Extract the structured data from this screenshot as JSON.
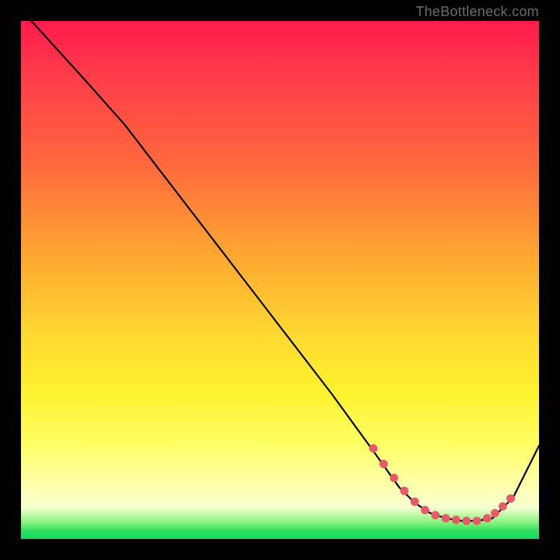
{
  "watermark": "TheBottleneck.com",
  "chart_data": {
    "type": "line",
    "title": "",
    "xlabel": "",
    "ylabel": "",
    "xlim": [
      0,
      100
    ],
    "ylim": [
      0,
      100
    ],
    "grid": false,
    "series": [
      {
        "name": "curve",
        "x": [
          2,
          12,
          20,
          30,
          40,
          50,
          60,
          68,
          73,
          76,
          79,
          82,
          85,
          88,
          91,
          95,
          100
        ],
        "y": [
          100,
          89,
          80,
          67,
          54,
          41,
          28,
          17,
          10,
          7,
          5,
          4,
          3.5,
          3.5,
          4,
          8,
          18
        ]
      }
    ],
    "markers": {
      "name": "highlight-dots",
      "x": [
        68,
        70,
        72,
        74,
        76,
        78,
        80,
        82,
        84,
        86,
        88,
        90,
        91.5,
        93,
        94.5
      ],
      "y": [
        17.5,
        14.5,
        11.8,
        9.3,
        7.2,
        5.6,
        4.6,
        4.0,
        3.7,
        3.5,
        3.5,
        4.0,
        5.0,
        6.3,
        7.8
      ]
    },
    "gradient_stops": [
      {
        "pos": 0,
        "color": "#ff1a4d"
      },
      {
        "pos": 28,
        "color": "#ff6a3d"
      },
      {
        "pos": 60,
        "color": "#ffd731"
      },
      {
        "pos": 90,
        "color": "#ffffb0"
      },
      {
        "pos": 97,
        "color": "#7ff07a"
      },
      {
        "pos": 100,
        "color": "#18d66a"
      }
    ]
  }
}
